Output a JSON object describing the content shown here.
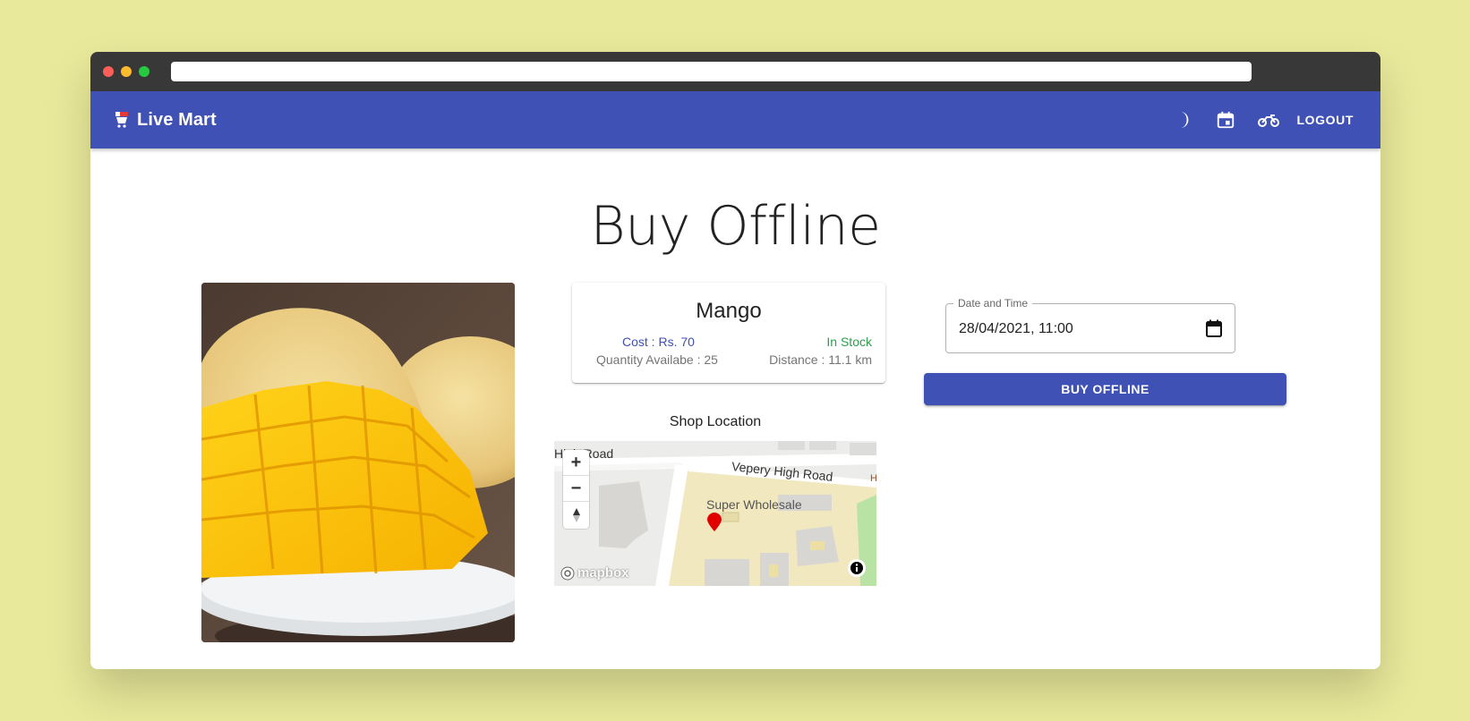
{
  "browser": {
    "url": ""
  },
  "appbar": {
    "brand": "Live Mart",
    "icons": [
      "dark-mode-icon",
      "calendar-icon",
      "delivery-bike-icon"
    ],
    "logout_label": "LOGOUT",
    "color": "#3f51b5"
  },
  "page": {
    "title": "Buy Offline"
  },
  "product": {
    "name": "Mango",
    "cost": "Cost : Rs. 70",
    "quantity": "Quantity Availabe : 25",
    "stock_status": "In Stock",
    "distance": "Distance : 11.1 km"
  },
  "shop_location": {
    "heading": "Shop Location",
    "map_labels": {
      "road_left": "High Road",
      "road_main": "Vepery High Road",
      "shop": "Super Wholesale",
      "edge_letter": "H"
    },
    "attribution": "mapbox"
  },
  "order": {
    "datetime_label": "Date and Time",
    "datetime_value": "28/04/2021, 11:00",
    "buy_button": "BUY OFFLINE"
  }
}
